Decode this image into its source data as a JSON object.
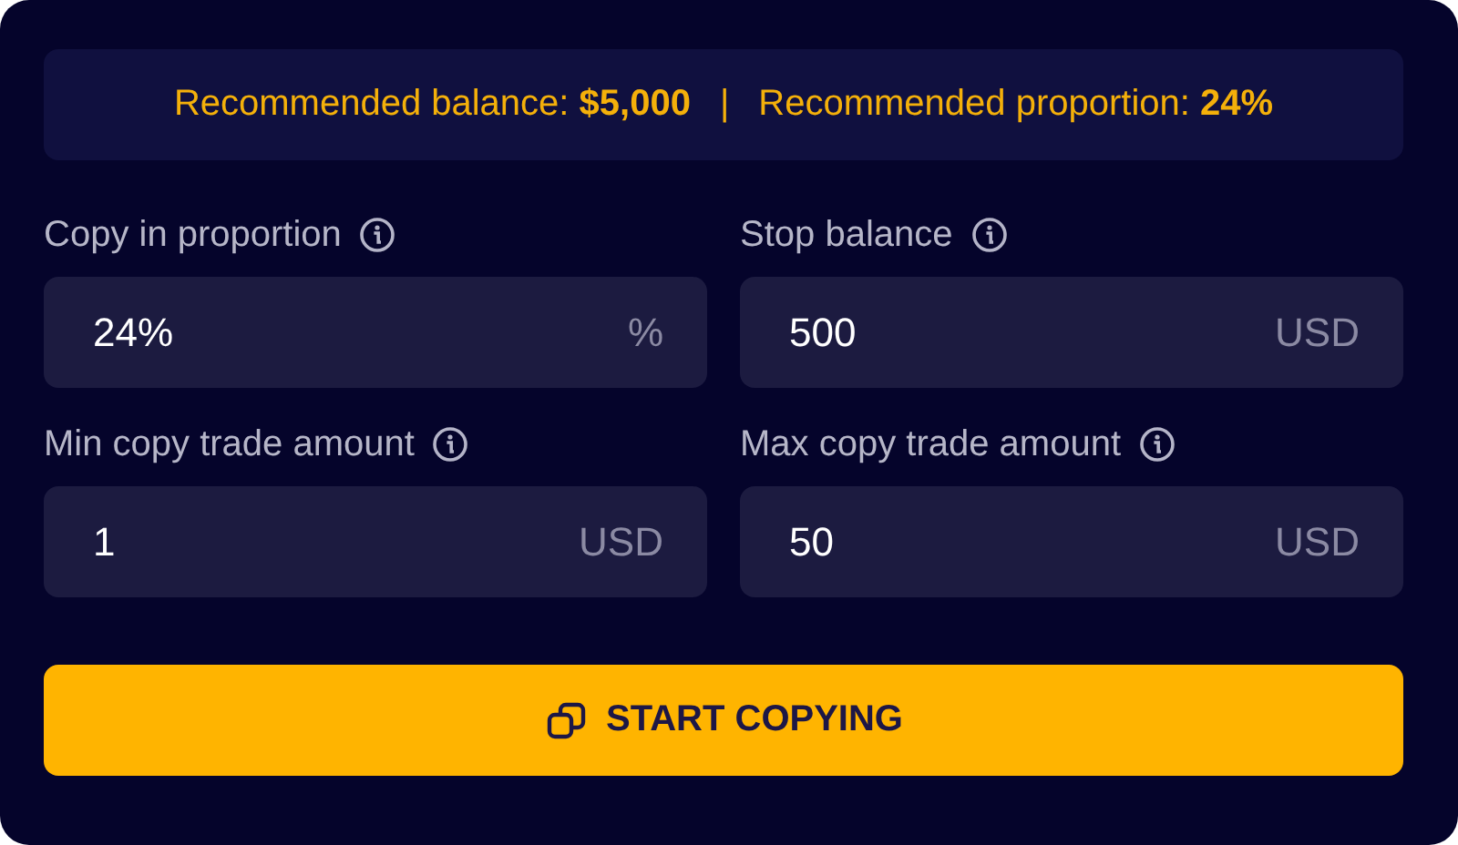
{
  "banner": {
    "items": [
      "Recommended balance: **$5,000**",
      "|",
      "Recommended proportion: **24%**"
    ]
  },
  "fields": [
    {
      "label": "Copy in proportion",
      "value": "24%",
      "unit": "%"
    },
    {
      "label": "Stop balance",
      "value": "500",
      "unit": "USD"
    },
    {
      "label": "Min copy trade amount",
      "value": "1",
      "unit": "USD"
    },
    {
      "label": "Max copy trade amount",
      "value": "50",
      "unit": "USD"
    }
  ],
  "button": {
    "label": "START COPYING"
  }
}
